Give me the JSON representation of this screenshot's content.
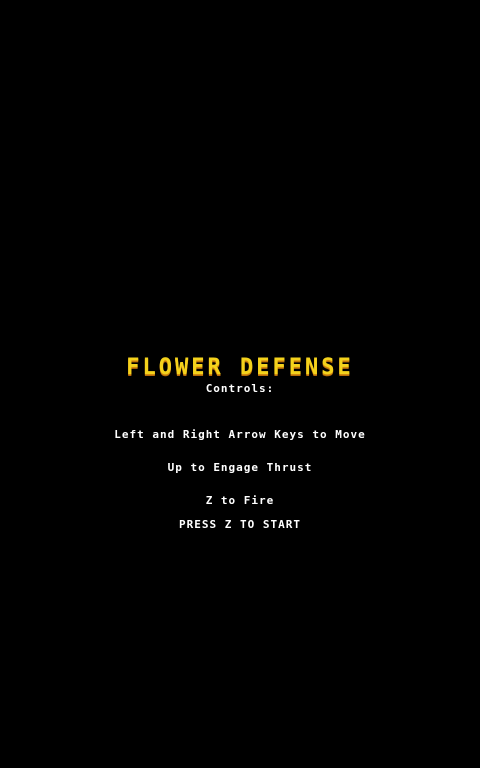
{
  "title": "FLOWER DEFENSE",
  "controls_heading": "Controls:",
  "controls": [
    "Left and Right Arrow Keys to Move",
    "Up to Engage Thrust",
    "Z to Fire"
  ],
  "start_prompt": "PRESS Z TO START",
  "colors": {
    "background": "#000000",
    "title": "#f4d21c",
    "text": "#ffffff"
  }
}
